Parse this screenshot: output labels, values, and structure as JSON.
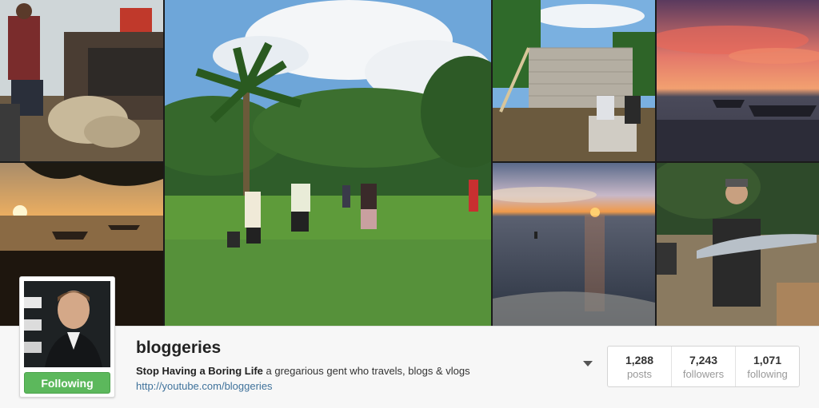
{
  "profile": {
    "username": "bloggeries",
    "bio_title": "Stop Having a Boring Life",
    "bio_text": " a gregarious gent who travels, blogs & vlogs",
    "link": "http://youtube.com/bloggeries",
    "follow_label": "Following"
  },
  "stats": [
    {
      "value": "1,288",
      "label": "posts"
    },
    {
      "value": "7,243",
      "label": "followers"
    },
    {
      "value": "1,071",
      "label": "following"
    }
  ],
  "grid_photos": [
    {
      "subject": "boat-cargo-deck"
    },
    {
      "subject": "palm-field-people"
    },
    {
      "subject": "cinderblock-construction"
    },
    {
      "subject": "pink-sunset-boats"
    },
    {
      "subject": "beach-sunset-silhouette"
    },
    {
      "subject": "ocean-sunset-swimmer"
    },
    {
      "subject": "man-holding-fish"
    }
  ],
  "colors": {
    "follow_green": "#5cb85c",
    "link_blue": "#3f729b"
  }
}
